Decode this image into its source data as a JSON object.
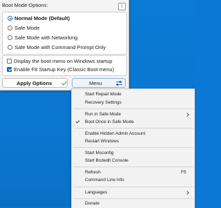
{
  "panel": {
    "title": "Boot Mode Options:",
    "info_glyph": "i",
    "boot_modes": [
      {
        "label": "Normal Mode (Default)",
        "selected": true
      },
      {
        "label": "Safe Mode",
        "selected": false
      },
      {
        "label": "Safe Mode with Networking",
        "selected": false
      },
      {
        "label": "Safe Mode with Command Prompt Only",
        "selected": false
      }
    ],
    "options": [
      {
        "label": "Display the boot menu on Windows startup",
        "checked": false
      },
      {
        "label": "Enable F8 Startup Key (Classic Boot menu)",
        "checked": true
      }
    ],
    "apply_label": "Apply Options",
    "menu_label": "Menu"
  },
  "menu": {
    "items": [
      {
        "label": "Start Repair Mode"
      },
      {
        "label": "Recovery Settings"
      },
      {
        "label": "Run in Safe Mode",
        "submenu": true
      },
      {
        "label": "Boot Once in Safe Mode",
        "checked": true
      },
      {
        "label": "Enable Hidden Admin Account"
      },
      {
        "label": "Restart Windows"
      },
      {
        "label": "Start Msconfig"
      },
      {
        "label": "Start Bcdedit Console"
      },
      {
        "label": "Refresh",
        "shortcut": "F5"
      },
      {
        "label": "Command Line Info"
      },
      {
        "label": "Languages",
        "submenu": true
      },
      {
        "label": "Donate"
      }
    ]
  },
  "colors": {
    "desktop": "#0a78d4",
    "accent": "#1867c0",
    "check_green": "#2e9e3e"
  }
}
